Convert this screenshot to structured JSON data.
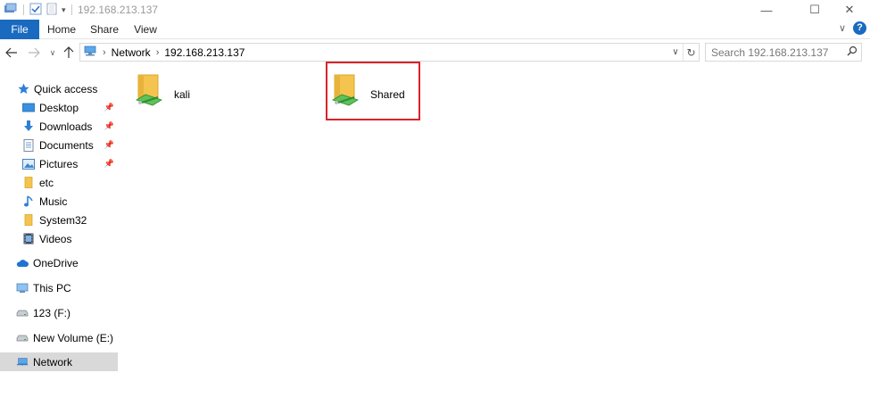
{
  "window": {
    "title": "192.168.213.137",
    "minimize_glyph": "—",
    "maximize_glyph": "☐",
    "close_glyph": "✕"
  },
  "ribbon": {
    "tabs": [
      {
        "label": "File"
      },
      {
        "label": "Home"
      },
      {
        "label": "Share"
      },
      {
        "label": "View"
      }
    ],
    "help_glyph": "?"
  },
  "address": {
    "crumbs": [
      "Network",
      "192.168.213.137"
    ],
    "search_placeholder": "Search 192.168.213.137"
  },
  "sidebar": {
    "quick_access": "Quick access",
    "items": [
      {
        "label": "Desktop",
        "icon": "desktop-icon",
        "pinned": true
      },
      {
        "label": "Downloads",
        "icon": "download-icon",
        "pinned": true
      },
      {
        "label": "Documents",
        "icon": "documents-icon",
        "pinned": true
      },
      {
        "label": "Pictures",
        "icon": "pictures-icon",
        "pinned": true
      },
      {
        "label": "etc",
        "icon": "folder-icon",
        "pinned": false
      },
      {
        "label": "Music",
        "icon": "music-icon",
        "pinned": false
      },
      {
        "label": "System32",
        "icon": "folder-icon",
        "pinned": false
      },
      {
        "label": "Videos",
        "icon": "videos-icon",
        "pinned": false
      }
    ],
    "onedrive": "OneDrive",
    "this_pc": "This PC",
    "drive_f": "123 (F:)",
    "drive_e": "New Volume (E:)",
    "network": "Network"
  },
  "content": {
    "shares": [
      {
        "label": "kali"
      },
      {
        "label": "Shared"
      }
    ]
  },
  "colors": {
    "accent": "#1a6ac0",
    "selection": "#d9d9d9",
    "highlight_box": "#d9232a",
    "folder": "#f4c44e"
  }
}
